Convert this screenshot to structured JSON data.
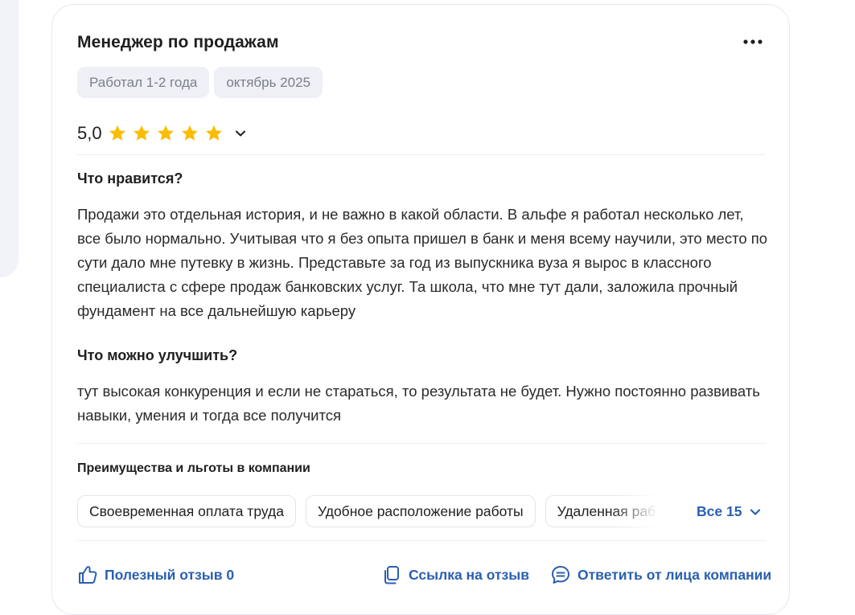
{
  "review": {
    "title": "Менеджер по продажам",
    "tags": [
      "Работал 1-2 года",
      "октябрь 2025"
    ],
    "rating": {
      "value": "5,0",
      "stars": 5,
      "max": 5,
      "star_color": "#fbbc05"
    },
    "likes_heading": "Что нравится?",
    "likes_text": "Продажи это отдельная история, и не важно в какой области. В альфе я работал несколько лет, все было нормально. Учитывая что я без опыта пришел в банк и меня всему научили, это место по сути дало мне путевку в жизнь. Представьте за год из выпускника вуза я вырос в классного специалиста с сфере продаж банковских услуг. Та школа, что мне тут дали, заложила прочный фундамент на все дальнейшую карьеру",
    "improve_heading": "Что можно улучшить?",
    "improve_text": "тут высокая конкуренция и если не стараться, то результата не будет. Нужно постоянно развивать навыки, умения и тогда все получится"
  },
  "benefits": {
    "heading": "Преимущества и льготы в компании",
    "chips": [
      "Своевременная оплата труда",
      "Удобное расположение работы",
      "Удаленная работа"
    ],
    "all_label": "Все 15"
  },
  "actions": {
    "helpful": "Полезный отзыв 0",
    "link": "Ссылка на отзыв",
    "reply": "Ответить от лица компании"
  },
  "colors": {
    "accent": "#2b5fb0",
    "tag_bg": "#eef0f5",
    "tag_text": "#7a7f8a"
  },
  "icons": [
    "more-icon",
    "star-icon",
    "chevron-down-icon",
    "thumbs-up-icon",
    "copy-link-icon",
    "comment-icon"
  ]
}
